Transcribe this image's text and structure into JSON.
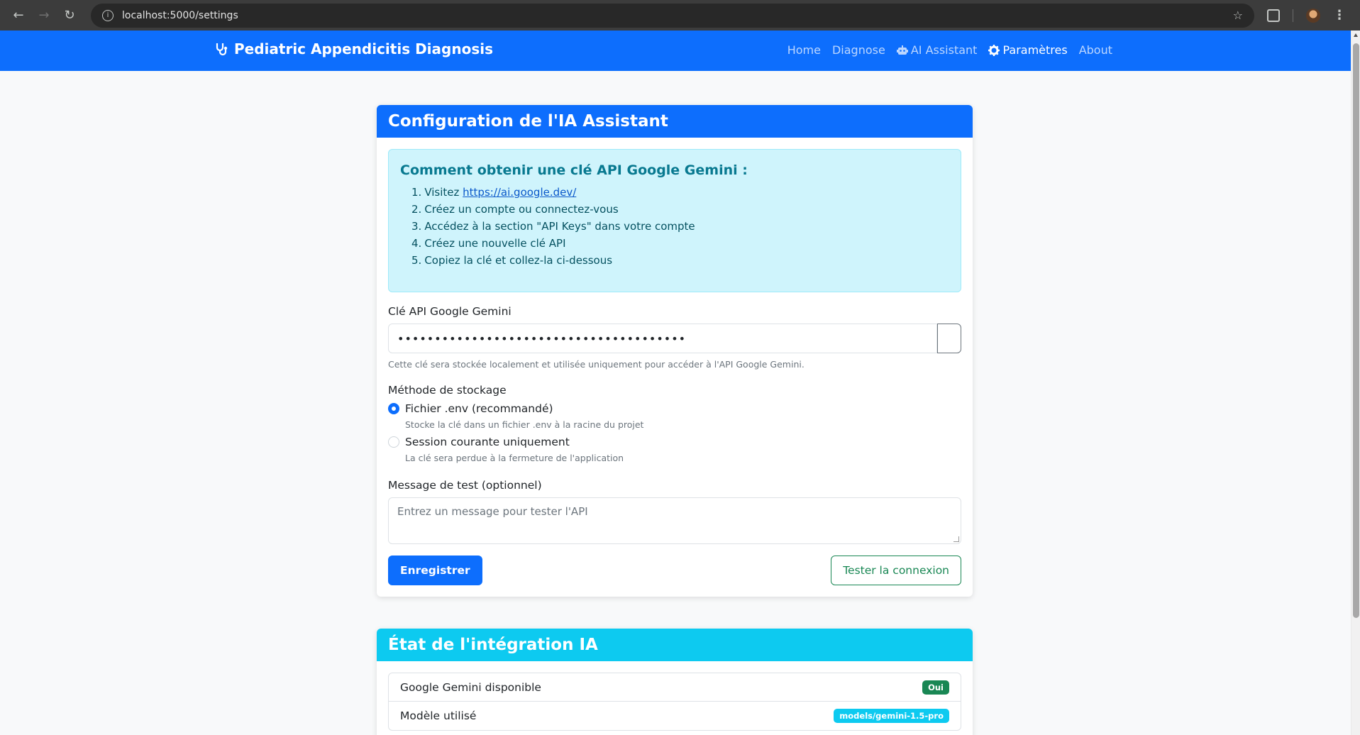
{
  "browser": {
    "url": "localhost:5000/settings"
  },
  "navbar": {
    "brand": "Pediatric Appendicitis Diagnosis",
    "links": [
      {
        "label": "Home"
      },
      {
        "label": "Diagnose"
      },
      {
        "label": "AI Assistant"
      },
      {
        "label": "Paramètres"
      },
      {
        "label": "About"
      }
    ]
  },
  "config_card": {
    "header": "Configuration de l'IA Assistant",
    "alert": {
      "title": "Comment obtenir une clé API Google Gemini :",
      "steps": [
        {
          "num": "1.",
          "text": "Visitez ",
          "link": "https://ai.google.dev/"
        },
        {
          "num": "2.",
          "text": "Créez un compte ou connectez-vous"
        },
        {
          "num": "3.",
          "text": "Accédez à la section \"API Keys\" dans votre compte"
        },
        {
          "num": "4.",
          "text": "Créez une nouvelle clé API"
        },
        {
          "num": "5.",
          "text": "Copiez la clé et collez-la ci-dessous"
        }
      ]
    },
    "api_key": {
      "label": "Clé API Google Gemini",
      "value": "•••••••••••••••••••••••••••••••••••••••",
      "help": "Cette clé sera stockée localement et utilisée uniquement pour accéder à l'API Google Gemini."
    },
    "storage": {
      "label": "Méthode de stockage",
      "options": [
        {
          "label": "Fichier .env (recommandé)",
          "desc": "Stocke la clé dans un fichier .env à la racine du projet",
          "checked": true
        },
        {
          "label": "Session courante uniquement",
          "desc": "La clé sera perdue à la fermeture de l'application",
          "checked": false
        }
      ]
    },
    "test_message": {
      "label": "Message de test (optionnel)",
      "placeholder": "Entrez un message pour tester l'API"
    },
    "buttons": {
      "save": "Enregistrer",
      "test": "Tester la connexion"
    }
  },
  "status_card": {
    "header": "État de l'intégration IA",
    "items": [
      {
        "label": "Google Gemini disponible",
        "badge": "Oui",
        "badge_color": "#198754"
      },
      {
        "label": "Modèle utilisé",
        "badge": "models/gemini-1.5-pro",
        "badge_color": "#0dcaf0"
      }
    ]
  }
}
